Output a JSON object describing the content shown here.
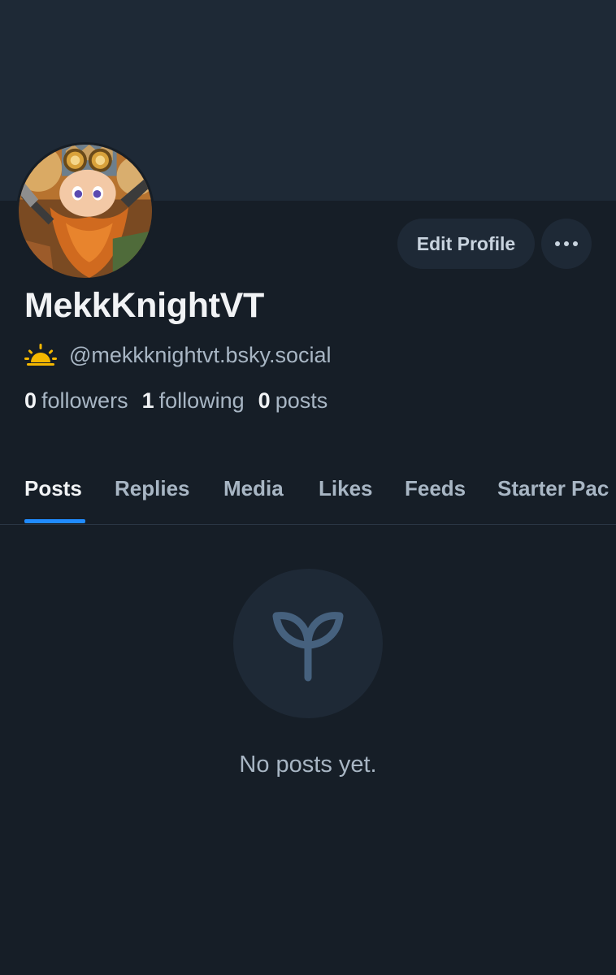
{
  "profile": {
    "display_name": "MekkKnightVT",
    "handle": "@mekkknightvt.bsky.social",
    "avatar_icon": "avatar-illustration",
    "status_icon": "sunrise-icon"
  },
  "actions": {
    "edit_profile": "Edit Profile",
    "more_icon": "ellipsis-icon"
  },
  "stats": {
    "followers_count": "0",
    "followers_label": "followers",
    "following_count": "1",
    "following_label": "following",
    "posts_count": "0",
    "posts_label": "posts"
  },
  "tabs": [
    {
      "label": "Posts",
      "active": true
    },
    {
      "label": "Replies",
      "active": false
    },
    {
      "label": "Media",
      "active": false
    },
    {
      "label": "Likes",
      "active": false
    },
    {
      "label": "Feeds",
      "active": false
    },
    {
      "label": "Starter Pac",
      "active": false
    }
  ],
  "empty_state": {
    "icon": "sprout-icon",
    "message": "No posts yet."
  },
  "colors": {
    "background": "#161e27",
    "banner": "#1e2936",
    "accent": "#208bfe",
    "muted_text": "#a8b6c4",
    "sun": "#f5b800"
  }
}
